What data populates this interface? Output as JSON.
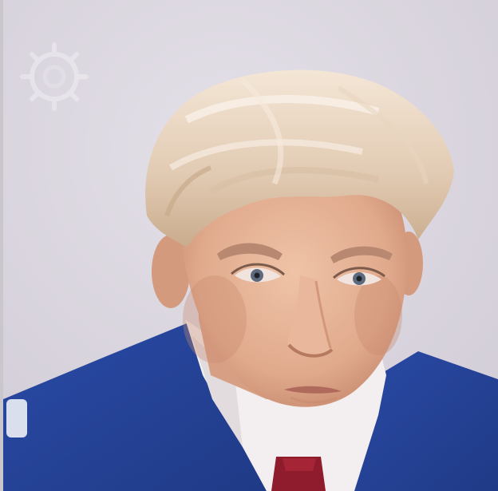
{
  "photo": {
    "subject": "portrait-photo",
    "watermark_icon": "seal-watermark-icon",
    "colors": {
      "background": "#dcd8e0",
      "suit": "#27449a",
      "shirt": "#f2eeee",
      "tie": "#8e1c2c",
      "hair": "#e6d2bd",
      "skin": "#e7b69b"
    }
  }
}
